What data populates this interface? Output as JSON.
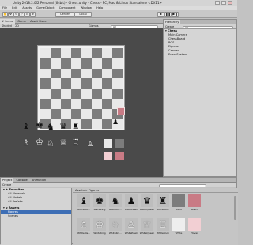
{
  "window": {
    "title": "Unity 2018.2.0f2 Personal (64bit) - Chess.unity - Chess - PC, Mac & Linux Standalone <DX11>"
  },
  "menu": [
    "File",
    "Edit",
    "Assets",
    "GameObject",
    "Component",
    "Window",
    "Help"
  ],
  "toolbar": {
    "center_label": "Center",
    "local_label": "Local"
  },
  "scene": {
    "tabs": [
      "# Scene",
      "Game",
      "Asset Store"
    ],
    "shading": "Shaded",
    "mode": "2D",
    "gizmos": "Gizmos",
    "search_placeholder": "All"
  },
  "hierarchy": {
    "tab": "Hierarchy",
    "create": "Create",
    "search_placeholder": "All",
    "scene_name": "Chess",
    "items": [
      "Main Camera",
      "ChessBoard",
      "BGS",
      "Figures",
      "Canvas",
      "EventSystem"
    ]
  },
  "palette": {
    "black_pieces": [
      "♝",
      "♚",
      "♞",
      "♛",
      "♜"
    ],
    "black_pawn": "♟",
    "white_pieces": [
      "♗",
      "♔",
      "♘",
      "♕",
      "♖"
    ],
    "white_pawn": "♙"
  },
  "colors": {
    "light_square": "#e9e9e9",
    "dark_square": "#7c7c7c",
    "highlight": "#c97b85",
    "highlight_light": "#f2cfd3"
  },
  "project": {
    "tabs": [
      "Project",
      "Console",
      "Animation"
    ],
    "create": "Create",
    "favorites": {
      "title": "Favorites",
      "items": [
        "All Materials",
        "All Models",
        "All Prefabs"
      ]
    },
    "assets": {
      "title": "Assets",
      "items": [
        "Figures",
        "Scenes"
      ]
    },
    "breadcrumb": "Assets > Figures",
    "row1": [
      "BlackBis...",
      "BlackKing",
      "BlackKni...",
      "BlackPawn",
      "BlackQueen",
      "BlackRook",
      "Black",
      "Board"
    ],
    "row2": [
      "WhiteBis...",
      "WhiteKing",
      "WhiteKni...",
      "WhitePawn",
      "WhiteQueen",
      "WhiteRook",
      "White",
      "Hover"
    ]
  }
}
